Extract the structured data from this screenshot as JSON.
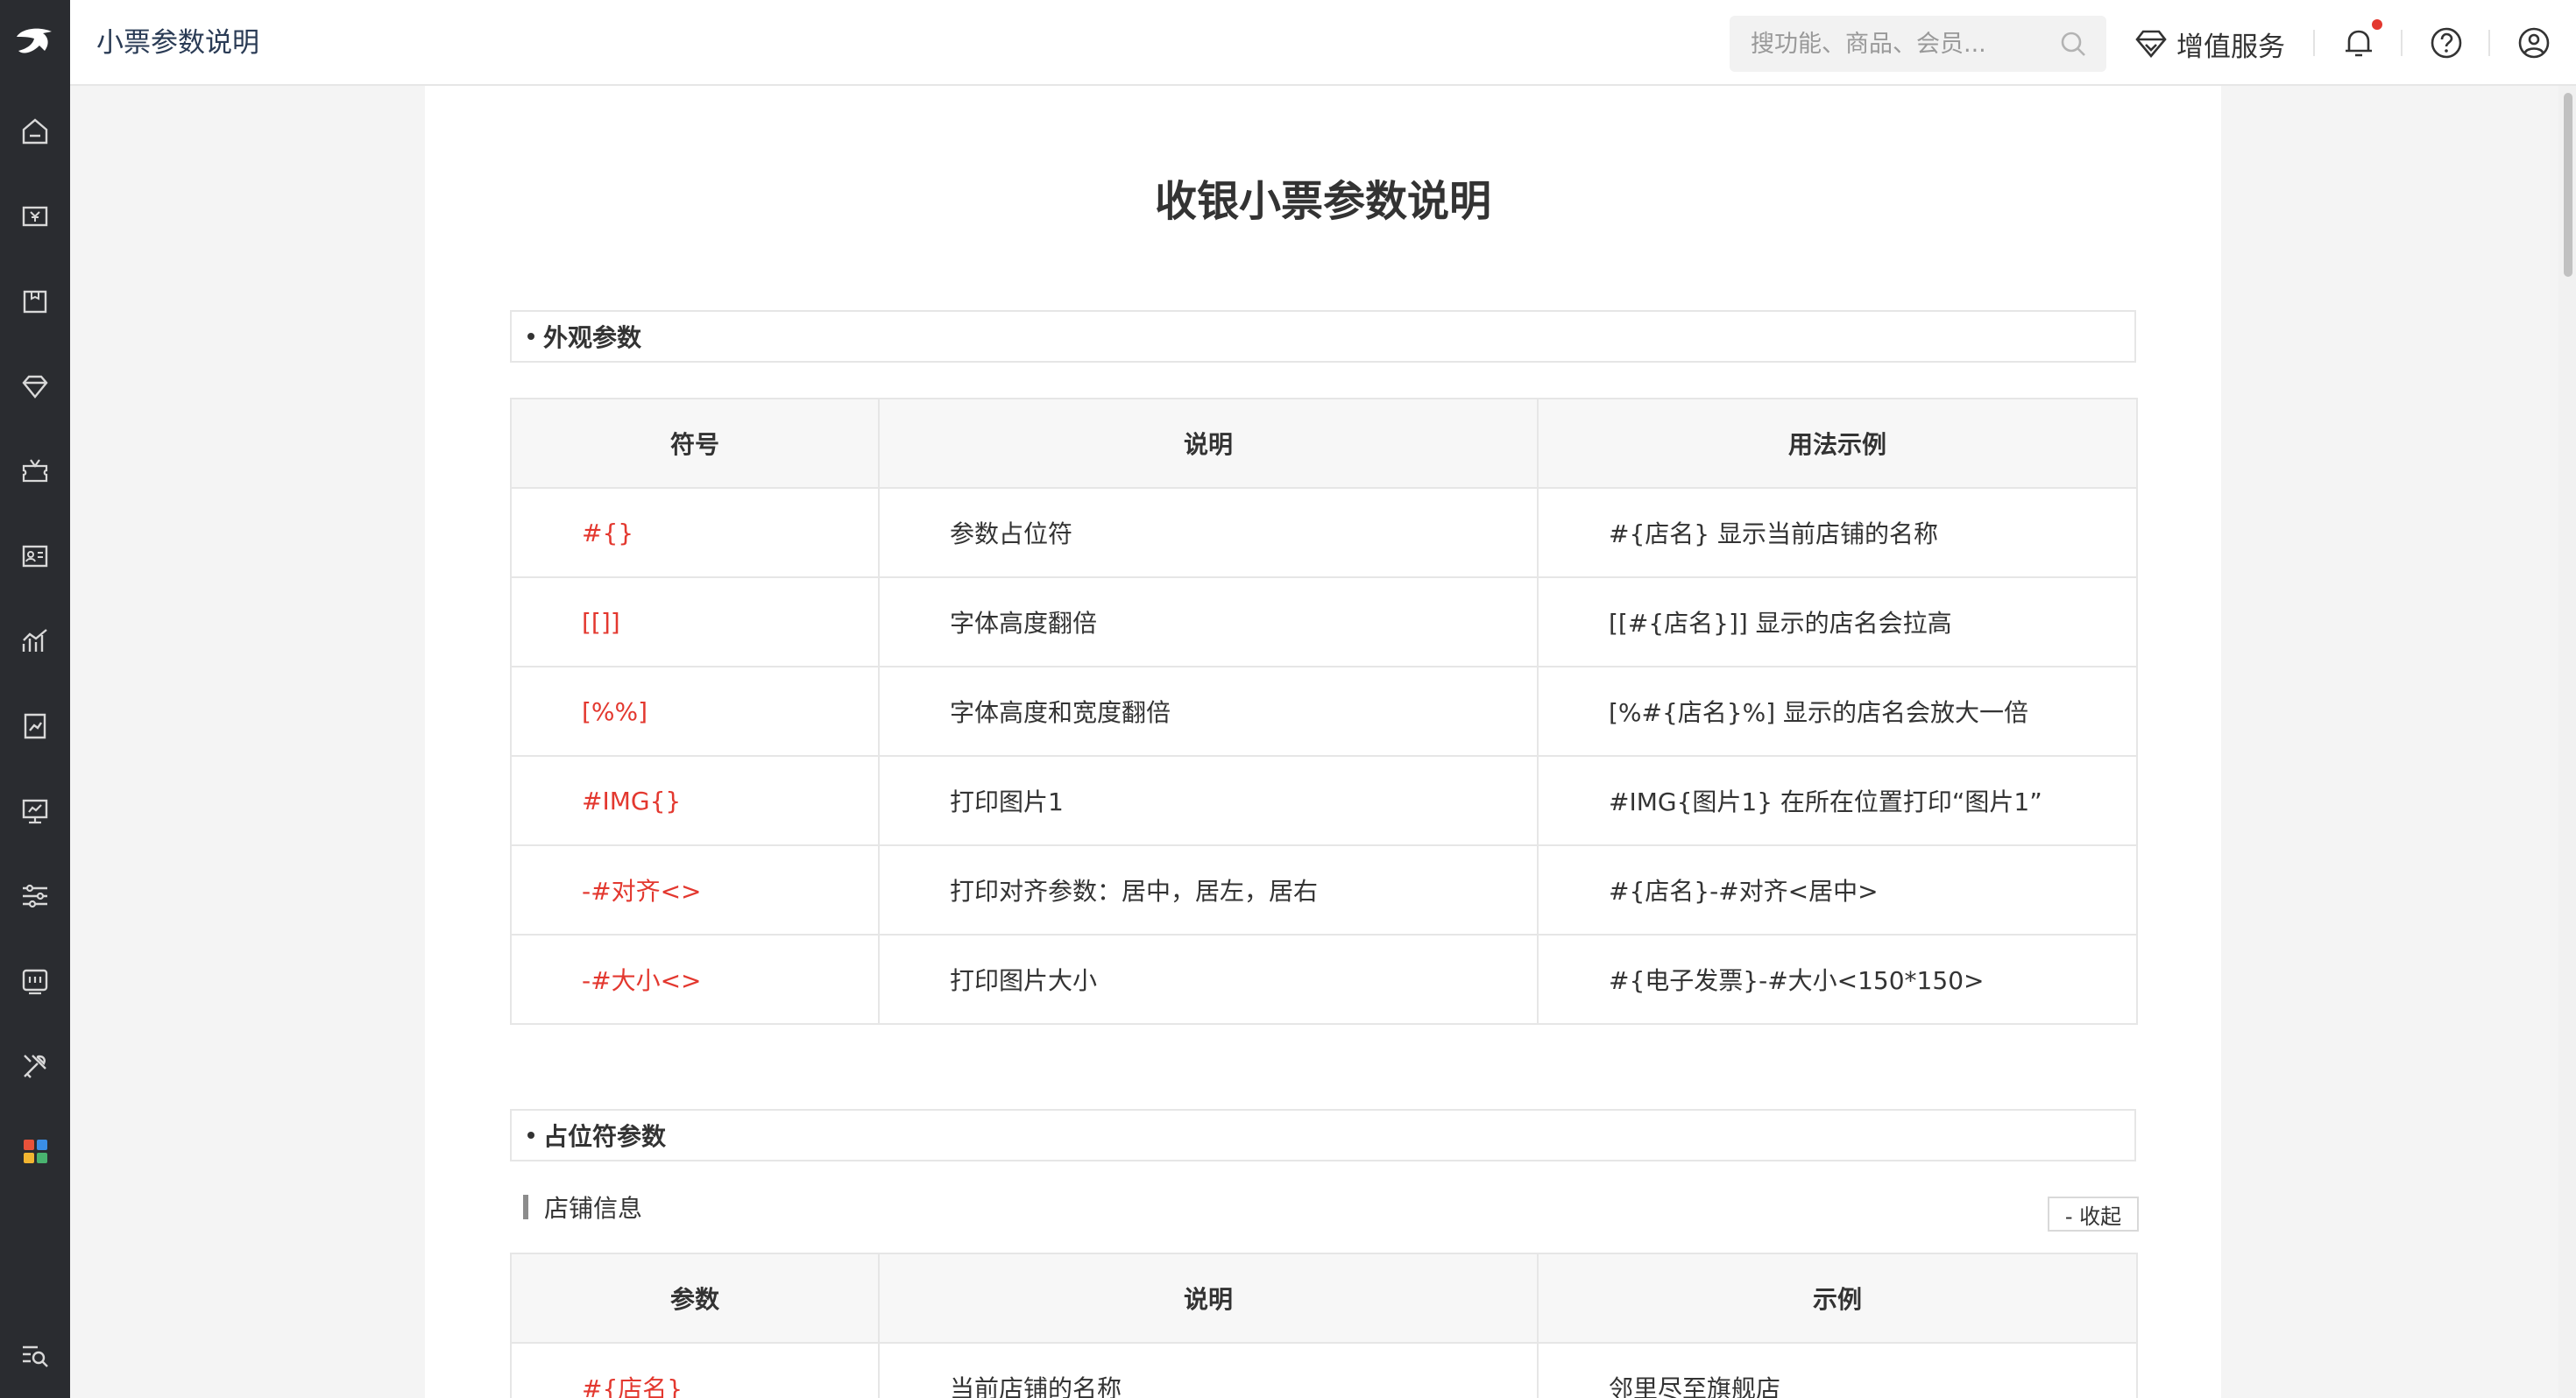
{
  "header": {
    "page_title": "小票参数说明",
    "search_placeholder": "搜功能、商品、会员...",
    "value_added_services": "增值服务"
  },
  "sidebar": {
    "items": [
      {
        "icon": "home-icon"
      },
      {
        "icon": "cashier-icon"
      },
      {
        "icon": "goods-icon"
      },
      {
        "icon": "member-icon"
      },
      {
        "icon": "marketing-icon"
      },
      {
        "icon": "staff-icon"
      },
      {
        "icon": "report-icon"
      },
      {
        "icon": "finance-icon"
      },
      {
        "icon": "online-store-icon"
      },
      {
        "icon": "settings-icon"
      },
      {
        "icon": "device-icon"
      },
      {
        "icon": "tools-icon"
      },
      {
        "icon": "apps-icon"
      },
      {
        "icon": "search-menu-icon"
      }
    ]
  },
  "doc": {
    "title": "收银小票参数说明",
    "appearance_section": "外观参数",
    "appearance_columns": [
      "符号",
      "说明",
      "用法示例"
    ],
    "appearance_rows": [
      {
        "symbol": "#{}",
        "desc": "参数占位符",
        "example": "#{店名} 显示当前店铺的名称"
      },
      {
        "symbol": "[[]]",
        "desc": "字体高度翻倍",
        "example": "[[#{店名}]] 显示的店名会拉高"
      },
      {
        "symbol": "[%%]",
        "desc": "字体高度和宽度翻倍",
        "example": "[%#{店名}%] 显示的店名会放大一倍"
      },
      {
        "symbol": "#IMG{}",
        "desc": "打印图片1",
        "example": "#IMG{图片1} 在所在位置打印“图片1”"
      },
      {
        "symbol": "-#对齐<>",
        "desc": "打印对齐参数：居中，居左，居右",
        "example": "#{店名}-#对齐<居中>"
      },
      {
        "symbol": "-#大小<>",
        "desc": "打印图片大小",
        "example": "#{电子发票}-#大小<150*150>"
      }
    ],
    "placeholder_section": "占位符参数",
    "store_info_label": "店铺信息",
    "collapse_label": "- 收起",
    "store_columns": [
      "参数",
      "说明",
      "示例"
    ],
    "store_rows": [
      {
        "param": "#{店名}",
        "desc": "当前店铺的名称",
        "example": "邻里尽至旗舰店"
      }
    ]
  },
  "colors": {
    "accent_red": "#e3382f",
    "sidebar_bg": "#2a2c30"
  }
}
